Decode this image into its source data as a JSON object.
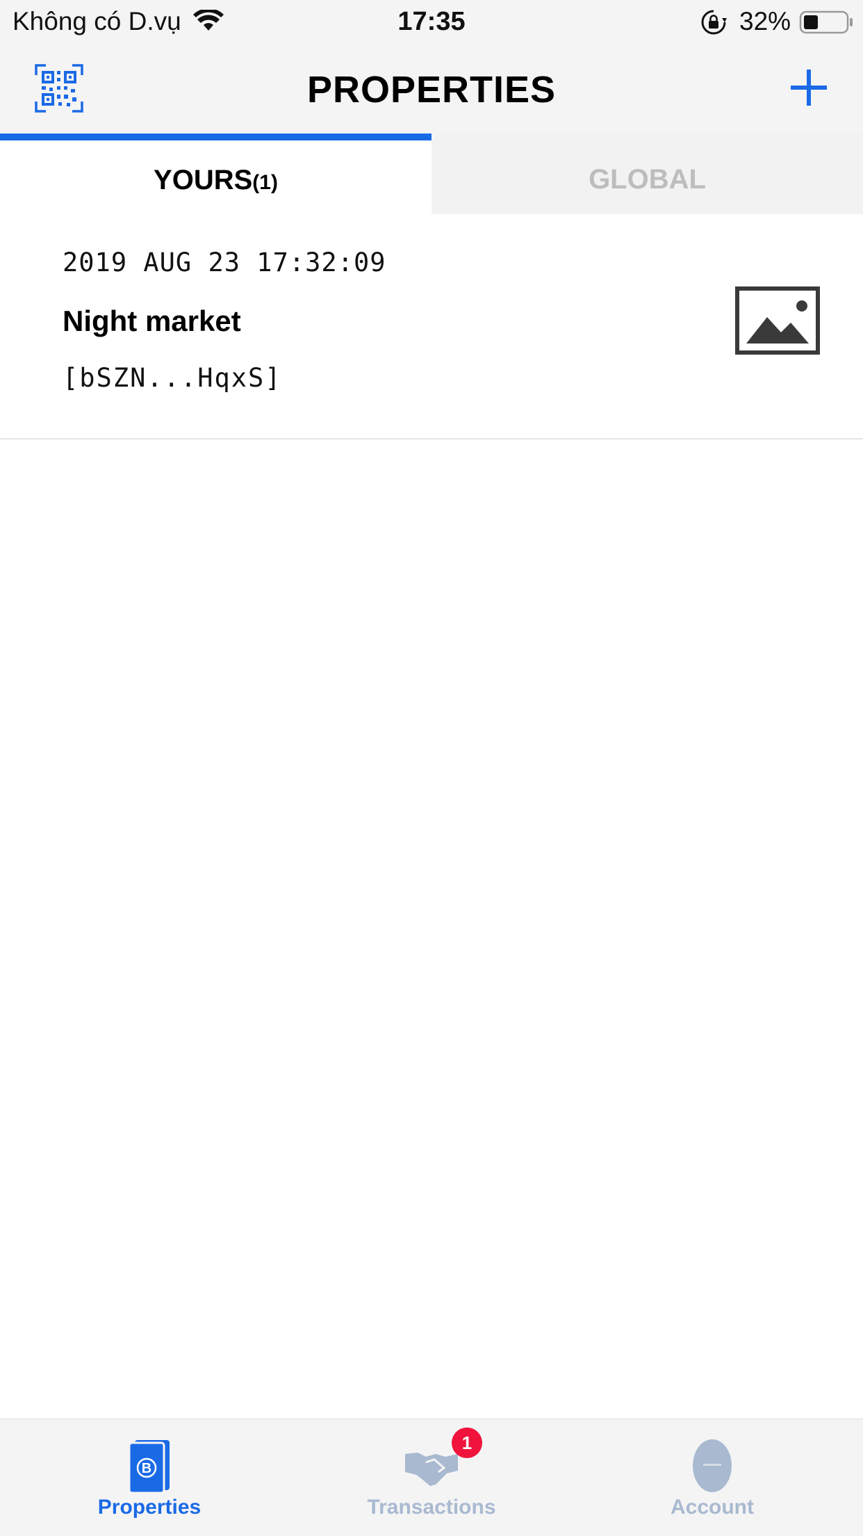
{
  "status_bar": {
    "carrier": "Không có D.vụ",
    "time": "17:35",
    "battery_percent": "32%"
  },
  "header": {
    "title": "PROPERTIES",
    "left_icon": "qr-code-icon",
    "right_icon": "plus-icon"
  },
  "tabs": {
    "yours_label": "YOURS",
    "yours_count": "(1)",
    "global_label": "GLOBAL",
    "active": "yours"
  },
  "properties": [
    {
      "date": "2019 AUG 23 17:32:09",
      "name": "Night market",
      "id": "[bSZN...HqxS]",
      "thumbnail_icon": "image-placeholder-icon"
    }
  ],
  "tab_bar": {
    "items": [
      {
        "label": "Properties",
        "icon": "bitcoin-document-icon",
        "active": true
      },
      {
        "label": "Transactions",
        "icon": "handshake-icon",
        "badge": "1"
      },
      {
        "label": "Account",
        "icon": "account-icon"
      }
    ]
  },
  "colors": {
    "accent": "#1a6ae6",
    "inactive_tab_text": "#bdbdbd",
    "inactive_tabbar": "#a9b9d0",
    "badge": "#f0143c"
  }
}
